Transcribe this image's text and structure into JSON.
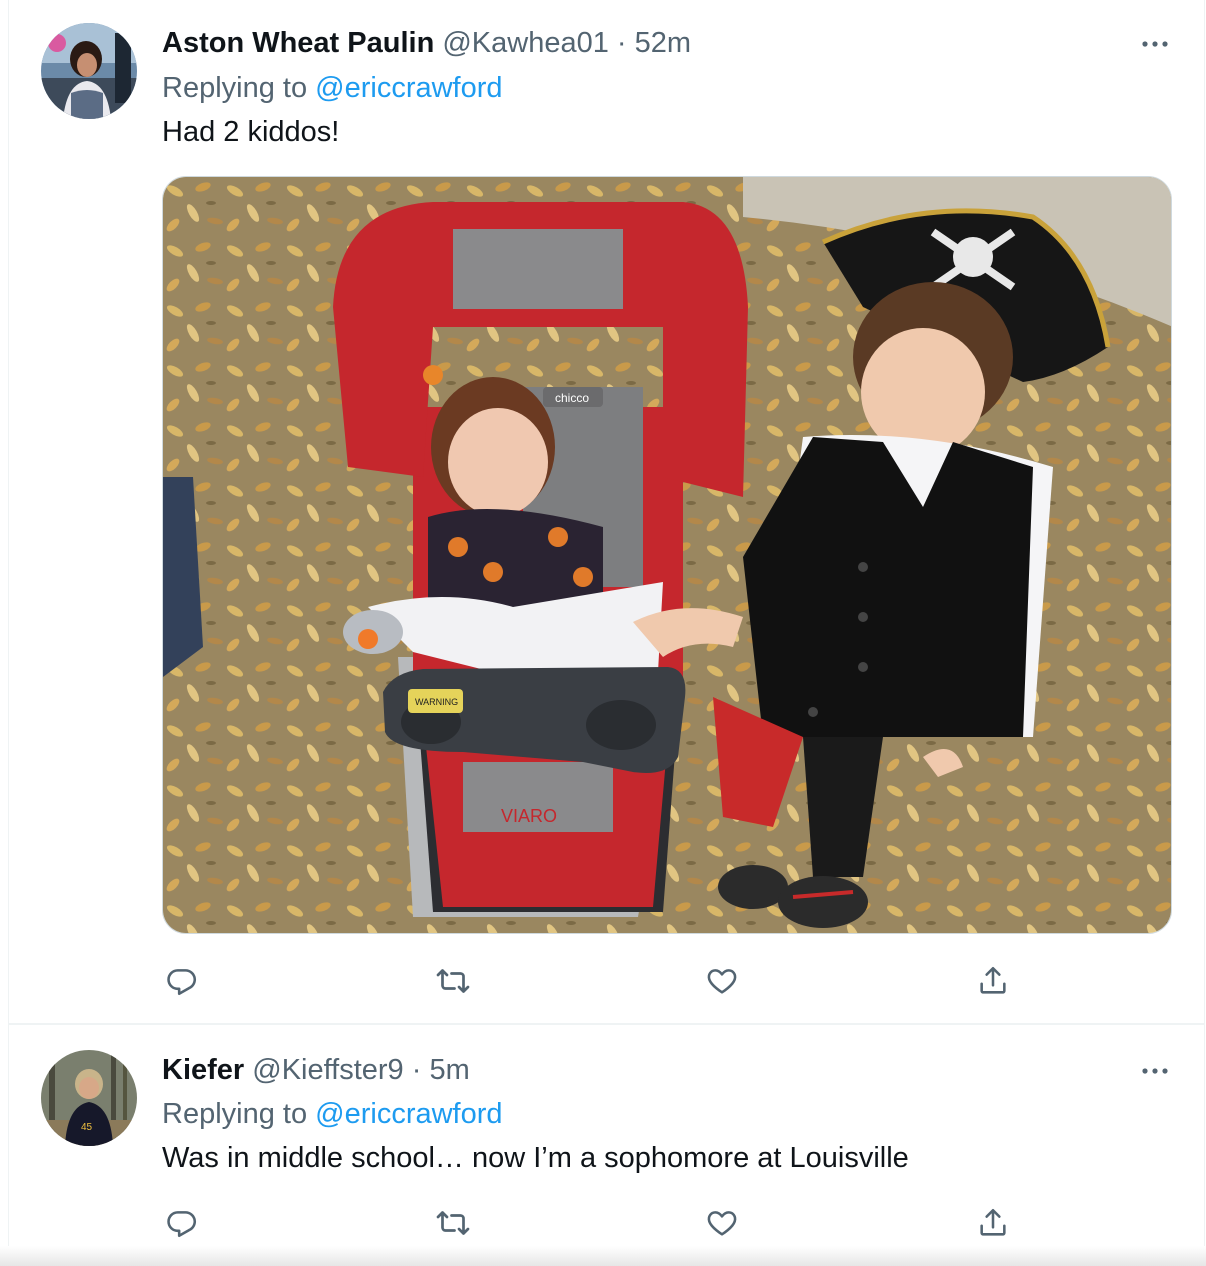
{
  "tweets": [
    {
      "author": {
        "name": "Aston Wheat Paulin",
        "handle": "@Kawhea01"
      },
      "separator": "·",
      "time": "52m",
      "reply_prefix": "Replying to ",
      "reply_to": "@ericcrawford",
      "text": "Had 2 kiddos!",
      "media": {
        "stroller_brand": "chicco",
        "stroller_model": "VIARO",
        "tray_label": "WARNING"
      }
    },
    {
      "author": {
        "name": "Kiefer",
        "handle": "@Kieffster9"
      },
      "separator": "·",
      "time": "5m",
      "reply_prefix": "Replying to ",
      "reply_to": "@ericcrawford",
      "text": "Was in middle school… now I’m a sophomore at Louisville"
    }
  ],
  "icons": {
    "more": "more-dots-icon",
    "reply": "reply-icon",
    "retweet": "retweet-icon",
    "like": "heart-icon",
    "share": "share-icon"
  },
  "colors": {
    "text_primary": "#0f1419",
    "text_secondary": "#536471",
    "link": "#1d9bf0",
    "border": "#eff3f4"
  }
}
